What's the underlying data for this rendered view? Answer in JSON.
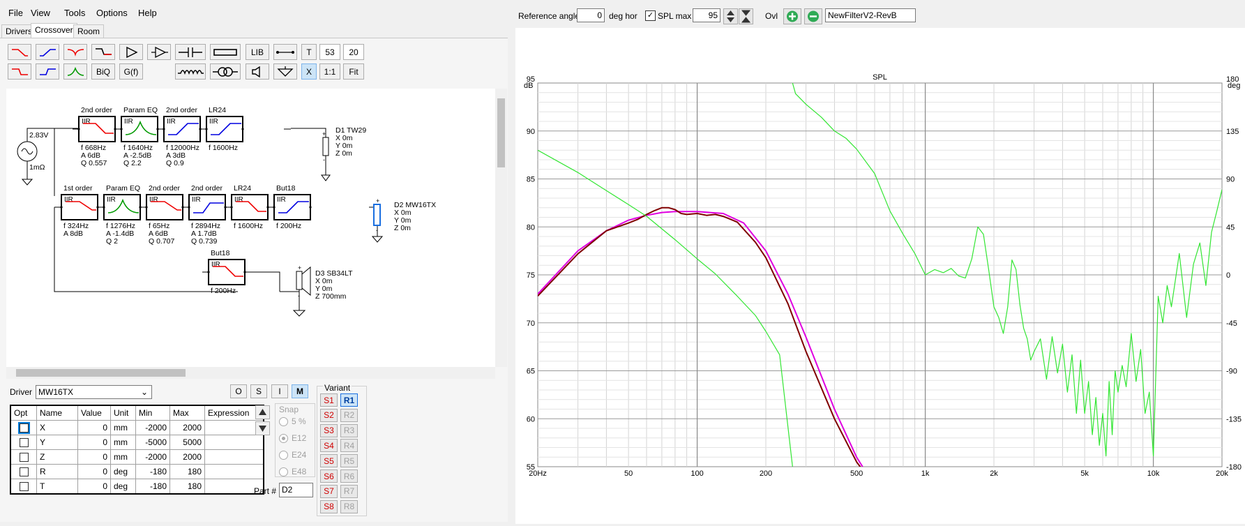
{
  "menu": [
    "File",
    "View",
    "Tools",
    "Options",
    "Help"
  ],
  "tabs": [
    "Drivers",
    "Crossover",
    "Room"
  ],
  "toolbar": {
    "lib_label": "LIB",
    "t_label": "T",
    "num1": "53",
    "num2": "20",
    "biq_label": "BiQ",
    "gf_label": "G(f)",
    "x_label": "X",
    "ratio_label": "1:1",
    "fit_label": "Fit"
  },
  "top_bar": {
    "ref_angle_label": "Reference angle",
    "ref_angle_value": "0",
    "deg_hor": "deg hor",
    "spl_max_label": "SPL max",
    "spl_max_value": "95",
    "ovl_label": "Ovl",
    "filter_name": "NewFilterV2-RevB"
  },
  "schematic": {
    "source_voltage": "2.83V",
    "source_impedance": "1mΩ",
    "drivers": [
      {
        "name": "D1 TW29",
        "x": "X 0m",
        "y": "Y 0m",
        "z": "Z 0m"
      },
      {
        "name": "D2 MW16TX",
        "x": "X 0m",
        "y": "Y 0m",
        "z": "Z 0m"
      },
      {
        "name": "D3 SB34LT",
        "x": "X 0m",
        "y": "Y 0m",
        "z": "Z 700mm"
      }
    ],
    "iir_tag": "IIR",
    "filters_row1": [
      {
        "title": "2nd order",
        "p": [
          "f  668Hz",
          "A  6dB",
          "Q  0.557"
        ]
      },
      {
        "title": "Param EQ",
        "p": [
          "f  1640Hz",
          "A  -2.5dB",
          "Q  2.2"
        ]
      },
      {
        "title": "2nd order",
        "p": [
          "f  12000Hz",
          "A  3dB",
          "Q  0.9"
        ]
      },
      {
        "title": "LR24",
        "p": [
          "f  1600Hz"
        ]
      }
    ],
    "filters_row2": [
      {
        "title": "1st order",
        "p": [
          "f  324Hz",
          "A  8dB"
        ]
      },
      {
        "title": "Param EQ",
        "p": [
          "f  1276Hz",
          "A  -1.4dB",
          "Q  2"
        ]
      },
      {
        "title": "2nd order",
        "p": [
          "f  65Hz",
          "A  6dB",
          "Q  0.707"
        ]
      },
      {
        "title": "2nd order",
        "p": [
          "f  2894Hz",
          "A  1.7dB",
          "Q  0.739"
        ]
      },
      {
        "title": "LR24",
        "p": [
          "f  1600Hz"
        ]
      },
      {
        "title": "But18",
        "p": [
          "f  200Hz"
        ]
      }
    ],
    "filters_row3": [
      {
        "title": "But18",
        "p": [
          "f  200Hz"
        ]
      }
    ]
  },
  "driver_panel": {
    "driver_label": "Driver",
    "driver_value": "MW16TX",
    "mode_buttons": [
      "O",
      "S",
      "I",
      "M"
    ],
    "table_headers": [
      "Opt",
      "Name",
      "Value",
      "Unit",
      "Min",
      "Max",
      "Expression"
    ],
    "rows": [
      {
        "name": "X",
        "value": "0",
        "unit": "mm",
        "min": "-2000",
        "max": "2000"
      },
      {
        "name": "Y",
        "value": "0",
        "unit": "mm",
        "min": "-5000",
        "max": "5000"
      },
      {
        "name": "Z",
        "value": "0",
        "unit": "mm",
        "min": "-2000",
        "max": "2000"
      },
      {
        "name": "R",
        "value": "0",
        "unit": "deg",
        "min": "-180",
        "max": "180"
      },
      {
        "name": "T",
        "value": "0",
        "unit": "deg",
        "min": "-180",
        "max": "180"
      }
    ],
    "snap_label": "Snap",
    "snap_options": [
      "5 %",
      "E12",
      "E24",
      "E48"
    ],
    "part_label": "Part #",
    "part_value": "D2",
    "variant_label": "Variant",
    "variants_s": [
      "S1",
      "S2",
      "S3",
      "S4",
      "S5",
      "S6",
      "S7",
      "S8"
    ],
    "variants_r": [
      "R1",
      "R2",
      "R3",
      "R4",
      "R5",
      "R6",
      "R7",
      "R8"
    ]
  },
  "chart_data": {
    "type": "line",
    "title": "SPL",
    "ylabel": "dB",
    "y2label": "deg",
    "xscale": "log",
    "xlim": [
      20,
      20000
    ],
    "ylim": [
      55,
      95
    ],
    "y2lim": [
      -180,
      180
    ],
    "x_ticks": [
      "20Hz",
      "50",
      "100",
      "200",
      "500",
      "1k",
      "2k",
      "5k",
      "10k",
      "20k"
    ],
    "y_ticks": [
      "95",
      "90",
      "85",
      "80",
      "75",
      "70",
      "65",
      "60",
      "55"
    ],
    "y2_ticks": [
      "180",
      "135",
      "90",
      "45",
      "0",
      "-45",
      "-90",
      "-135",
      "-180"
    ],
    "grid": true,
    "colors": {
      "spl": "#e000e0",
      "spl_measured": "#800000",
      "phase": "#33e633"
    },
    "series": [
      {
        "color": "#e000e0",
        "x": [
          20,
          30,
          40,
          50,
          60,
          70,
          80,
          100,
          130,
          160,
          200,
          250,
          300,
          400,
          500,
          600
        ],
        "y": [
          73,
          77.5,
          79.6,
          80.7,
          81.2,
          81.5,
          81.6,
          81.6,
          81.4,
          80.4,
          77.5,
          73,
          68.5,
          61,
          56,
          53
        ]
      },
      {
        "color": "#800000",
        "x": [
          20,
          30,
          40,
          50,
          55,
          60,
          65,
          70,
          75,
          80,
          85,
          90,
          100,
          110,
          120,
          130,
          140,
          150,
          180,
          200,
          250,
          300,
          400,
          500,
          600
        ],
        "y": [
          72.8,
          77.2,
          79.6,
          80.4,
          80.8,
          81.3,
          81.7,
          82,
          82,
          81.8,
          81.4,
          81.3,
          81.4,
          81.2,
          81.3,
          81.1,
          80.8,
          80.5,
          78.4,
          76.8,
          72,
          67,
          60,
          55.5,
          53
        ]
      },
      {
        "color": "#33e633",
        "x": [
          20,
          30,
          40,
          50,
          60,
          80,
          100,
          120,
          150,
          180,
          200,
          230,
          262
        ],
        "y": [
          117,
          96,
          79,
          66,
          55,
          33,
          15,
          1,
          -20,
          -38,
          -53,
          -75,
          -180
        ]
      },
      {
        "color": "#33e633",
        "x": [
          262,
          270,
          300,
          350,
          400,
          450,
          500,
          600,
          700,
          800,
          900,
          1000,
          1100,
          1200,
          1300,
          1400,
          1500,
          1600,
          1700,
          1800,
          1900,
          2000,
          2100,
          2200,
          2300,
          2400,
          2500,
          2600,
          2700,
          2800,
          2900,
          3000,
          3200,
          3400,
          3600,
          3800,
          4000,
          4200,
          4400,
          4600,
          4800,
          5000,
          5200,
          5400,
          5600,
          5800,
          6000,
          6200,
          6400,
          6600,
          6800,
          7000,
          7300,
          7600,
          8000,
          8400,
          8800,
          9200,
          9600,
          10000,
          10500,
          11000,
          11500,
          12000,
          13000,
          14000,
          15000,
          16000,
          17000,
          18000,
          19000,
          20000
        ],
        "y": [
          180,
          170,
          160,
          148,
          135,
          128,
          118,
          95,
          60,
          38,
          20,
          0,
          5,
          2,
          6,
          -1,
          -3,
          15,
          45,
          38,
          4,
          -30,
          -40,
          -55,
          -30,
          14,
          5,
          -28,
          -50,
          -60,
          -80,
          -72,
          -60,
          -98,
          -58,
          -92,
          -65,
          -110,
          -75,
          -130,
          -80,
          -130,
          -100,
          -150,
          -115,
          -160,
          -130,
          -170,
          -100,
          -150,
          -90,
          -110,
          -85,
          -105,
          -55,
          -100,
          -70,
          -130,
          -110,
          -170,
          -20,
          -45,
          -10,
          -30,
          20,
          -40,
          10,
          30,
          -10,
          40,
          60,
          80
        ]
      }
    ]
  }
}
